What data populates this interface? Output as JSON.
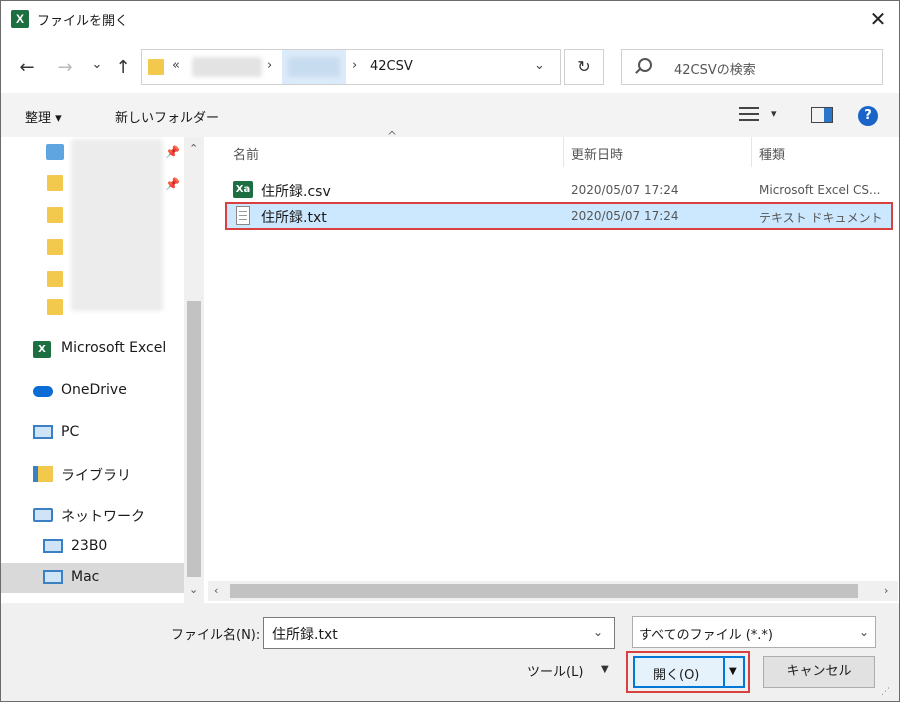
{
  "title_bar": {
    "app_icon_text": "X",
    "title": "ファイルを開く",
    "close_glyph": "✕"
  },
  "nav": {
    "back_glyph": "←",
    "forward_glyph": "→",
    "recent_glyph": "⌄",
    "up_glyph": "↑",
    "address": {
      "overflow_glyph": "«",
      "separator_glyph": "›",
      "current_folder": "42CSV",
      "dropdown_glyph": "⌄"
    },
    "refresh_glyph": "↻",
    "search": {
      "placeholder": "42CSVの検索"
    }
  },
  "toolbar": {
    "organize": "整理 ▾",
    "new_folder": "新しいフォルダー",
    "view_dropdown_glyph": "▾",
    "help_glyph": "?"
  },
  "sidebar": {
    "pin_glyph": "📌",
    "items": [
      {
        "label": "Microsoft Excel",
        "icon": "excel-icon"
      },
      {
        "label": "OneDrive",
        "icon": "onedrive-icon"
      },
      {
        "label": "PC",
        "icon": "pc-icon"
      },
      {
        "label": "ライブラリ",
        "icon": "library-icon"
      },
      {
        "label": "ネットワーク",
        "icon": "network-icon"
      },
      {
        "label": "23B0",
        "icon": "computer-icon"
      },
      {
        "label": "Mac",
        "icon": "computer-icon"
      }
    ],
    "scroll_down_glyph": "⌄"
  },
  "file_list": {
    "sort_glyph": "^",
    "columns": {
      "name": "名前",
      "date": "更新日時",
      "type": "種類"
    },
    "files": [
      {
        "name": "住所録.csv",
        "date": "2020/05/07 17:24",
        "type": "Microsoft Excel CS...",
        "icon": "excel-csv-icon"
      },
      {
        "name": "住所録.txt",
        "date": "2020/05/07 17:24",
        "type": "テキスト ドキュメント",
        "icon": "text-file-icon"
      }
    ],
    "scroll_left_glyph": "‹",
    "scroll_right_glyph": "›"
  },
  "bottom": {
    "filename_label": "ファイル名(N):",
    "filename_value": "住所録.txt",
    "filetype_value": "すべてのファイル (*.*)",
    "dropdown_glyph": "⌄",
    "tools_label": "ツール(L)",
    "tools_arrow": "▼",
    "open_label": "開く(O)",
    "open_arrow": "▼",
    "cancel_label": "キャンセル",
    "grip_glyph": "⋰"
  }
}
